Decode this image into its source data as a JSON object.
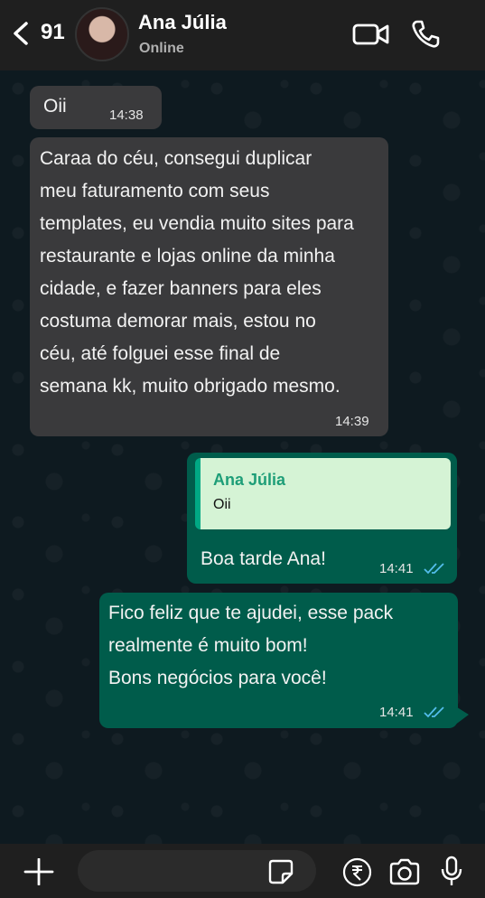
{
  "header": {
    "unread_count": "91",
    "contact_name": "Ana Júlia",
    "status": "Online"
  },
  "messages": [
    {
      "direction": "in",
      "text": "Oii",
      "time": "14:38"
    },
    {
      "direction": "in",
      "text": " Caraa do céu, consegui duplicar\nmeu faturamento com seus\ntemplates, eu vendia muito sites para\nrestaurante e lojas online da minha\ncidade, e fazer banners para eles\ncostuma demorar mais, estou no\ncéu, até folguei esse final de\nsemana kk, muito obrigado mesmo.",
      "time": "14:39"
    },
    {
      "direction": "out",
      "quote": {
        "author": "Ana Júlia",
        "text": "Oii"
      },
      "text": "Boa tarde Ana!",
      "time": "14:41",
      "status": "read"
    },
    {
      "direction": "out",
      "text": " Fico feliz que te ajudei, esse pack\nrealmente é muito bom!\nBons negócios para você!",
      "time": "14:41",
      "status": "read"
    }
  ],
  "composer": {
    "placeholder": "",
    "value": ""
  },
  "colors": {
    "incoming_bubble": "#3a3a3c",
    "outgoing_bubble": "#005c4b",
    "quote_accent": "#00a884",
    "read_ticks": "#53bdeb",
    "header_bar": "#1f1f1f"
  },
  "icons": {
    "back": "chevron-left-icon",
    "video": "video-camera-icon",
    "call": "phone-icon",
    "attach": "plus-icon",
    "sticker": "sticker-icon",
    "payment": "rupee-icon",
    "camera": "camera-icon",
    "mic": "microphone-icon"
  }
}
